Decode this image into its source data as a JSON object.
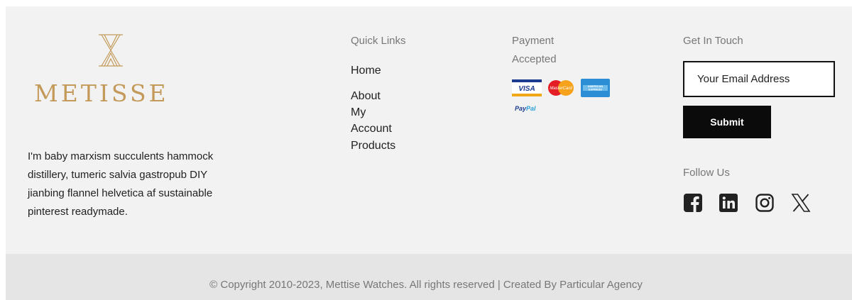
{
  "brand": {
    "name": "METISSE",
    "description": "I'm baby marxism succulents hammock distillery, tumeric salvia gastropub DIY jianbing flannel helvetica af sustainable pinterest readymade.",
    "color": "#c49a5a"
  },
  "quick_links": {
    "heading": "Quick Links",
    "items": [
      {
        "label": "Home"
      },
      {
        "label": "About"
      },
      {
        "label": "My Account"
      },
      {
        "label": "Products"
      }
    ]
  },
  "payment": {
    "heading": "Payment Accepted",
    "cards": [
      "VISA",
      "MasterCard",
      "AMERICAN EXPRESS",
      "PayPal"
    ]
  },
  "contact": {
    "heading": "Get In Touch",
    "email_placeholder": "Your Email Address",
    "submit_label": "Submit"
  },
  "social": {
    "heading": "Follow Us",
    "icons": [
      "facebook-icon",
      "linkedin-icon",
      "instagram-icon",
      "x-icon"
    ]
  },
  "footer": {
    "copyright": "© Copyright 2010-2023, Mettise Watches. All rights reserved | Created By Particular Agency"
  }
}
